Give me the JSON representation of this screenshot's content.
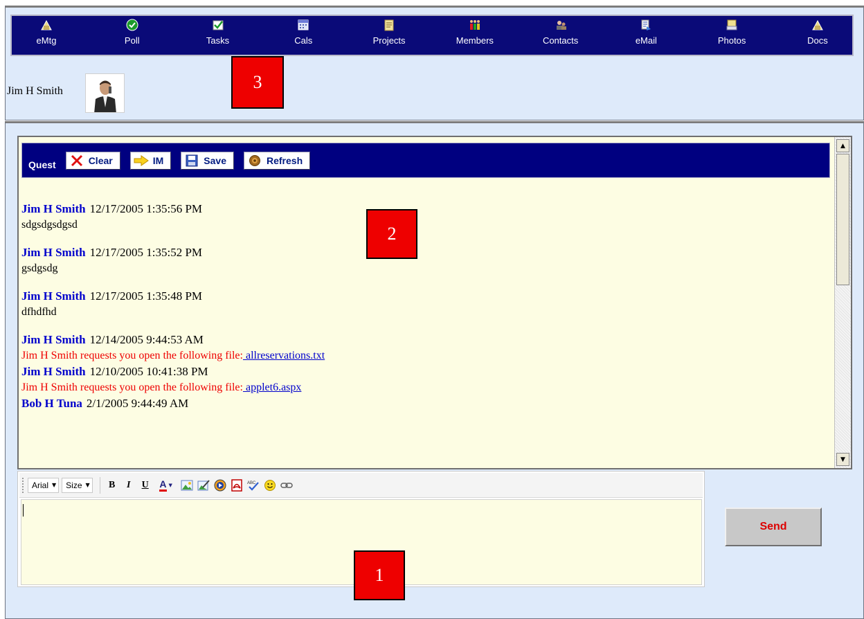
{
  "nav": {
    "items": [
      {
        "label": "eMtg",
        "icon": "emtg-icon"
      },
      {
        "label": "Poll",
        "icon": "poll-icon"
      },
      {
        "label": "Tasks",
        "icon": "tasks-icon"
      },
      {
        "label": "Cals",
        "icon": "calendar-icon"
      },
      {
        "label": "Projects",
        "icon": "projects-icon"
      },
      {
        "label": "Members",
        "icon": "members-icon"
      },
      {
        "label": "Contacts",
        "icon": "contacts-icon"
      },
      {
        "label": "eMail",
        "icon": "email-icon"
      },
      {
        "label": "Photos",
        "icon": "photos-icon"
      },
      {
        "label": "Docs",
        "icon": "docs-icon"
      }
    ]
  },
  "user": {
    "name": "Jim H Smith"
  },
  "markers": {
    "one": "1",
    "two": "2",
    "three": "3"
  },
  "chat": {
    "toolbar": {
      "title": "Quest",
      "clear": "Clear",
      "im": "IM",
      "save": "Save",
      "refresh": "Refresh"
    },
    "messages": [
      {
        "author": "Jim H Smith",
        "time": "12/17/2005 1:35:56 PM",
        "text": "sdgsdgsdgsd"
      },
      {
        "author": "Jim H Smith",
        "time": "12/17/2005 1:35:52 PM",
        "text": "gsdgsdg"
      },
      {
        "author": "Jim H Smith",
        "time": "12/17/2005 1:35:48 PM",
        "text": "dfhdfhd"
      },
      {
        "author": "Jim H Smith",
        "time": "12/14/2005 9:44:53 AM",
        "request": "Jim H Smith requests you open the following file:",
        "file": " allreservations.txt"
      },
      {
        "author": "Jim H Smith",
        "time": "12/10/2005 10:41:38 PM",
        "request": "Jim H Smith requests you open the following file:",
        "file": " applet6.aspx"
      },
      {
        "author": "Bob H Tuna",
        "time": "2/1/2005 9:44:49 AM"
      }
    ]
  },
  "editor": {
    "font": "Arial",
    "size": "Size",
    "bold": "B",
    "italic": "I",
    "underline": "U",
    "color": "A"
  },
  "send": {
    "label": "Send"
  },
  "colors": {
    "nav_bg": "#0a0a78",
    "frame_bg": "#deeafa",
    "chat_bg": "#fdfde3",
    "author": "#0000cc",
    "request": "#ee0000",
    "marker": "#ee0000"
  }
}
